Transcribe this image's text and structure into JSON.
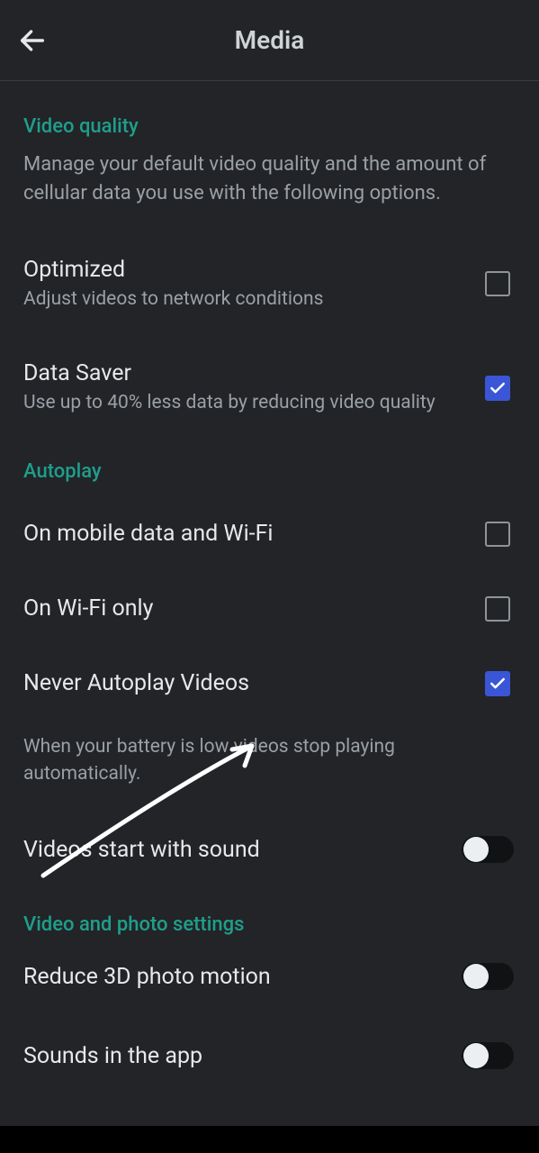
{
  "header": {
    "title": "Media"
  },
  "video_quality": {
    "title": "Video quality",
    "desc": "Manage your default video quality and the amount of cellular data you use with the following options.",
    "optimized": {
      "label": "Optimized",
      "sub": "Adjust videos to network conditions",
      "checked": false
    },
    "data_saver": {
      "label": "Data Saver",
      "sub": "Use up to 40% less data by reducing video quality",
      "checked": true
    }
  },
  "autoplay": {
    "title": "Autoplay",
    "mobile_wifi": {
      "label": "On mobile data and Wi-Fi",
      "checked": false
    },
    "wifi_only": {
      "label": "On Wi-Fi only",
      "checked": false
    },
    "never": {
      "label": "Never Autoplay Videos",
      "checked": true
    },
    "note": "When your battery is low videos stop playing automatically.",
    "videos_sound": {
      "label": "Videos start with sound",
      "on": false
    }
  },
  "video_photo": {
    "title": "Video and photo settings",
    "reduce_3d": {
      "label": "Reduce 3D photo motion",
      "on": false
    },
    "sounds_app": {
      "label": "Sounds in the app",
      "on": false
    }
  }
}
